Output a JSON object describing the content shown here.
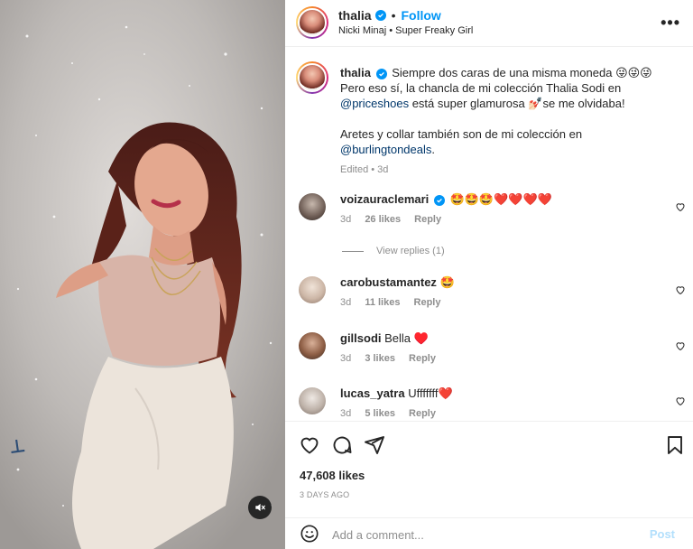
{
  "post": {
    "username": "thalia",
    "follow_label": "Follow",
    "song": "Nicki Minaj • Super Freaky Girl",
    "more_label": "•••"
  },
  "caption": {
    "username": "thalia",
    "line1": "Siempre dos caras de una misma moneda 😜😜😜",
    "line2": "Pero eso sí, la chancla de mi colección Thalia Sodi en",
    "mention1": "@priceshoes",
    "line3": " está super glamurosa 💅🏻se me olvidaba!",
    "line4": "Aretes y collar también son de mi colección en",
    "mention2": "@burlingtondeals",
    "line4_end": ".",
    "meta": "Edited • 3d"
  },
  "comments": [
    {
      "username": "voizauraclemari",
      "text": "🤩🤩🤩❤️❤️❤️❤️",
      "age": "3d",
      "likes": "26 likes",
      "reply": "Reply",
      "verified": true
    },
    {
      "username": "carobustamantez",
      "text": "🤩",
      "age": "3d",
      "likes": "11 likes",
      "reply": "Reply",
      "verified": false
    },
    {
      "username": "gillsodi",
      "text": "Bella ♥️",
      "age": "3d",
      "likes": "3 likes",
      "reply": "Reply",
      "verified": false
    },
    {
      "username": "lucas_yatra",
      "text": "Ufffffff❤️",
      "age": "3d",
      "likes": "5 likes",
      "reply": "Reply",
      "verified": false
    }
  ],
  "view_replies": "View replies (1)",
  "actions": {
    "likes": "47,608 likes",
    "date": "3 DAYS AGO"
  },
  "add_comment": {
    "placeholder": "Add a comment...",
    "post_label": "Post"
  },
  "colors": {
    "accent": "#0095f6",
    "text": "#262626",
    "muted": "#8e8e8e",
    "link": "#00376b",
    "post_disabled": "#b2dffc"
  }
}
